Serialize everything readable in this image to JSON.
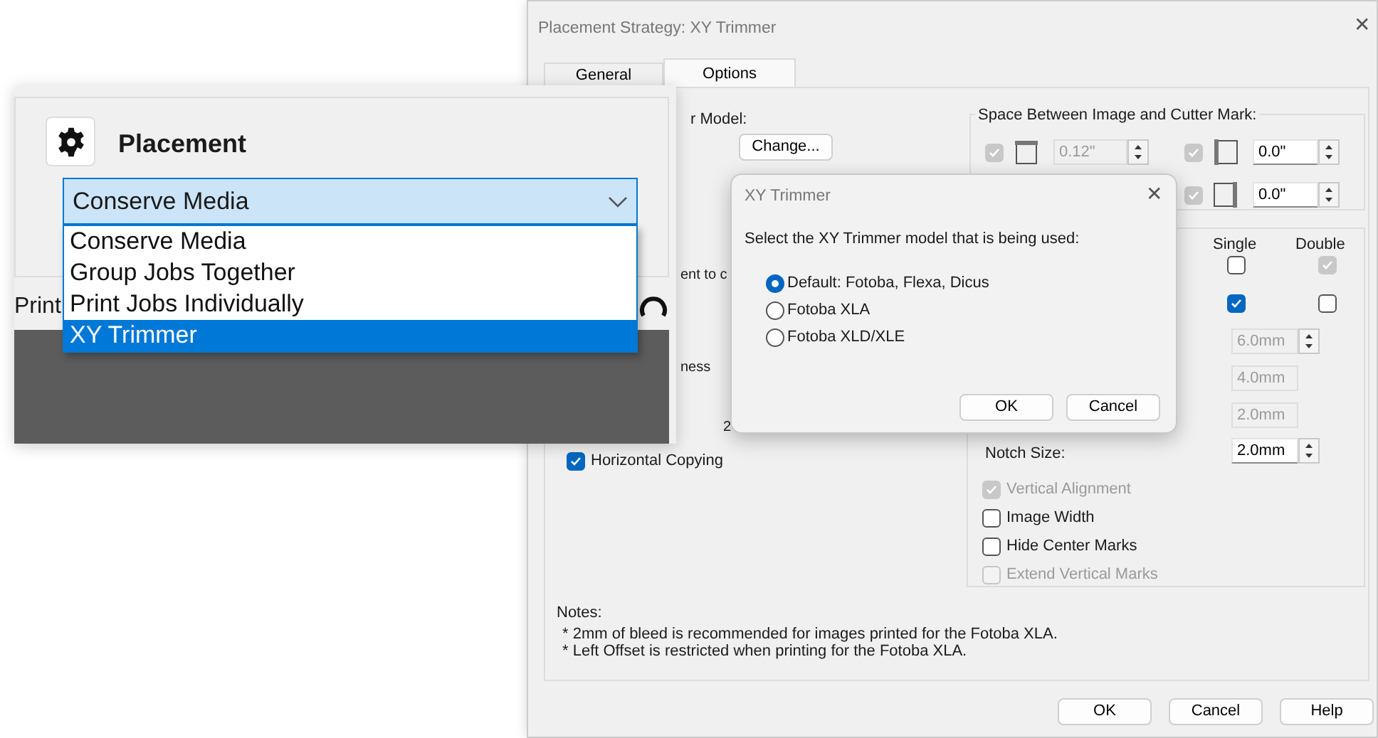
{
  "main_dialog": {
    "title": "Placement Strategy: XY Trimmer",
    "close": "✕",
    "tabs": [
      {
        "label": "General",
        "selected": false
      },
      {
        "label": "Options",
        "selected": true
      }
    ],
    "model_label": "r Model:",
    "change_button": "Change...",
    "fragments": [
      "ent to c",
      "ness",
      "2"
    ],
    "horizontal_copying": {
      "label": "Horizontal Copying",
      "checked": true
    },
    "spacing_group": {
      "title": "Space Between Image and Cutter Mark:",
      "items": [
        {
          "kind": "top",
          "checked": true,
          "disabled": true,
          "value": "0.12\"",
          "field_disabled": true
        },
        {
          "kind": "left",
          "checked": true,
          "disabled": true,
          "value": "0.0\"",
          "field_disabled": false
        },
        {
          "kind": "right",
          "checked": true,
          "disabled": true,
          "value": "0.0\"",
          "field_disabled": false
        }
      ]
    },
    "mark_group": {
      "columns": [
        "Single",
        "Double"
      ],
      "check_rows": [
        [
          {
            "checked": false,
            "disabled": false
          },
          {
            "checked": true,
            "disabled": true
          }
        ],
        [
          {
            "checked": true,
            "disabled": false
          },
          {
            "checked": false,
            "disabled": false
          }
        ]
      ],
      "fields": [
        {
          "value": "6.0mm",
          "disabled": true,
          "spinner": true
        },
        {
          "value": "4.0mm",
          "disabled": true,
          "spinner": false
        },
        {
          "value": "2.0mm",
          "disabled": true,
          "spinner": false
        },
        {
          "label": "Notch Size:",
          "value": "2.0mm",
          "disabled": false,
          "spinner": true
        }
      ],
      "options": [
        {
          "label": "Vertical Alignment",
          "checked": true,
          "disabled": true
        },
        {
          "label": "Image Width",
          "checked": false,
          "disabled": false
        },
        {
          "label": "Hide Center Marks",
          "checked": false,
          "disabled": false
        },
        {
          "label": "Extend Vertical Marks",
          "checked": false,
          "disabled": true
        }
      ]
    },
    "notes": {
      "title": "Notes:",
      "lines": [
        "* 2mm of bleed is recommended for images printed for the Fotoba XLA.",
        "* Left Offset is restricted when printing for the Fotoba XLA."
      ]
    },
    "buttons": [
      "OK",
      "Cancel",
      "Help"
    ]
  },
  "trimmer_dialog": {
    "title": "XY Trimmer",
    "close": "✕",
    "prompt": "Select the XY Trimmer model that is being used:",
    "options": [
      {
        "label": "Default: Fotoba, Flexa, Dicus",
        "selected": true
      },
      {
        "label": "Fotoba XLA",
        "selected": false
      },
      {
        "label": "Fotoba XLD/XLE",
        "selected": false
      }
    ],
    "buttons": [
      "OK",
      "Cancel"
    ]
  },
  "placement_panel": {
    "title": "Placement",
    "select_value": "Conserve Media",
    "options": [
      {
        "label": "Conserve Media",
        "selected": false
      },
      {
        "label": "Group Jobs Together",
        "selected": false
      },
      {
        "label": "Print Jobs Individually",
        "selected": false
      },
      {
        "label": "XY Trimmer",
        "selected": true
      }
    ],
    "print_label": "Print"
  }
}
